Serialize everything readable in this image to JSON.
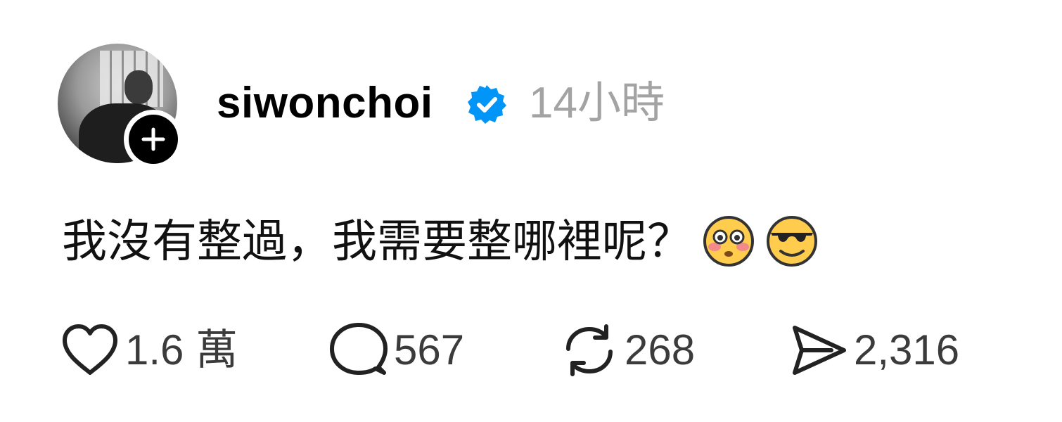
{
  "post": {
    "author": {
      "username": "siwonchoi",
      "verified": true,
      "avatar_desc": "profile-photo",
      "follow_icon": "plus-icon"
    },
    "timestamp": "14小時",
    "text": "我沒有整過，我需要整哪裡呢？",
    "emojis": [
      "flushed-face-emoji",
      "smiling-face-with-sunglasses-emoji"
    ],
    "stats": {
      "likes": "1.6 萬",
      "replies": "567",
      "reposts": "268",
      "shares": "2,316"
    }
  },
  "icons": {
    "like": "heart-icon",
    "reply": "speech-bubble-icon",
    "repost": "repost-arrows-icon",
    "share": "paper-plane-icon",
    "verified": "verified-badge-icon"
  },
  "colors": {
    "verified_blue": "#0095f6",
    "timestamp_gray": "#a3a3a3",
    "text": "#111111",
    "count_gray": "#3b3b3b"
  }
}
